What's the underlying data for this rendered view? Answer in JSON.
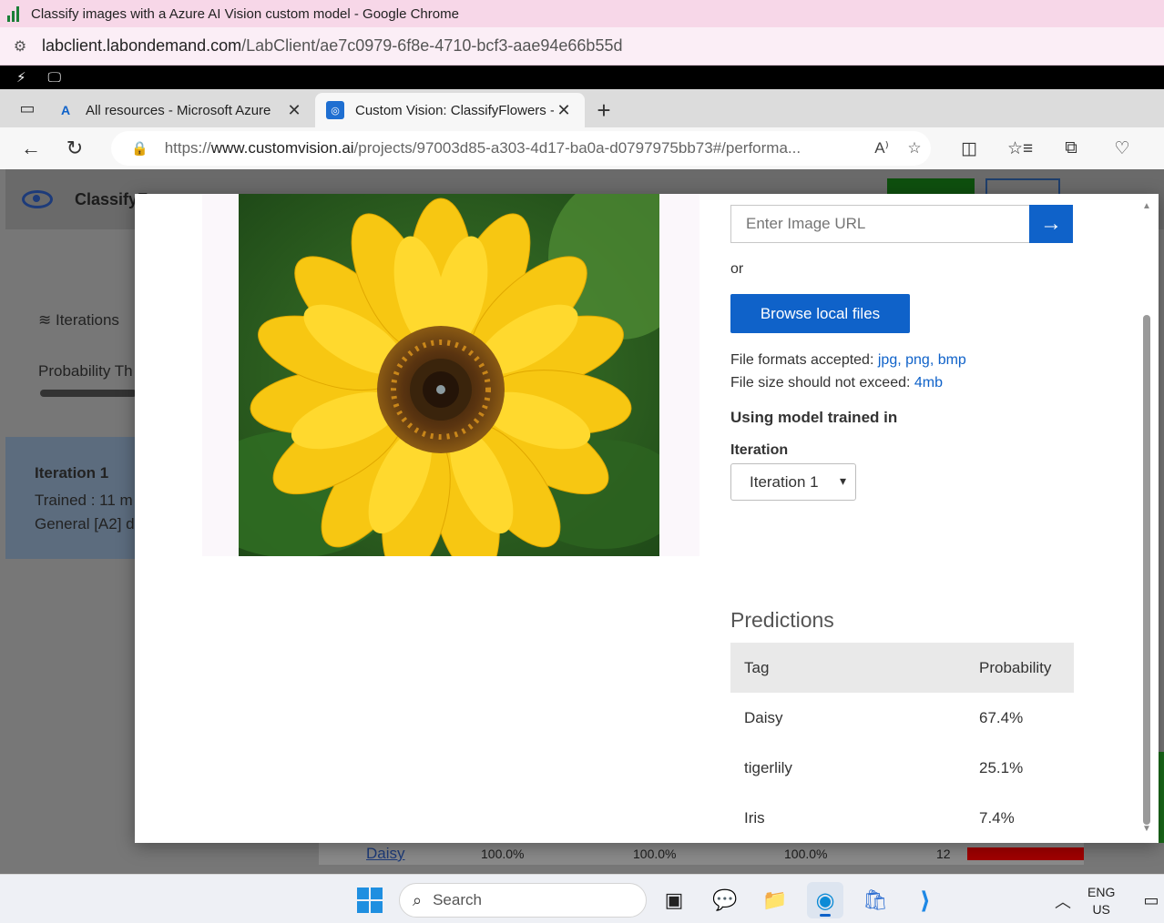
{
  "window": {
    "title": "Classify images with a Azure AI Vision custom model - Google Chrome",
    "url_domain": "labclient.labondemand.com",
    "url_path": "/LabClient/ae7c0979-6f8e-4710-bcf3-aae94e66b55d"
  },
  "tabs": [
    {
      "label": "All resources - Microsoft Azure"
    },
    {
      "label": "Custom Vision: ClassifyFlowers -"
    }
  ],
  "address": {
    "prefix": "https://",
    "domain": "www.customvision.ai",
    "path": "/projects/97003d85-a303-4d17-ba0a-d0797975bb73#/performa..."
  },
  "background": {
    "project_title": "ClassifyF",
    "iterations_label": "Iterations",
    "probability_label": "Probability Th",
    "iteration_card": {
      "title": "Iteration 1",
      "trained": "Trained : 11 m",
      "domain": "General [A2] d"
    },
    "bottom_row": {
      "tag": "Daisy",
      "v1": "100.0%",
      "v2": "100.0%",
      "v3": "100.0%",
      "count": "12"
    }
  },
  "quick_test": {
    "url_placeholder": "Enter Image URL",
    "or_text": "or",
    "browse_label": "Browse local files",
    "formats_label": "File formats accepted:",
    "formats": [
      "jpg",
      "png",
      "bmp"
    ],
    "size_label": "File size should not exceed:",
    "size_value": "4mb",
    "model_title": "Using model trained in",
    "iteration_label": "Iteration",
    "iteration_selected": "Iteration 1"
  },
  "predictions": {
    "title": "Predictions",
    "headers": {
      "tag": "Tag",
      "probability": "Probability"
    },
    "rows": [
      {
        "tag": "Daisy",
        "probability": "67.4%"
      },
      {
        "tag": "tigerlily",
        "probability": "25.1%"
      },
      {
        "tag": "Iris",
        "probability": "7.4%"
      }
    ]
  },
  "taskbar": {
    "search_placeholder": "Search",
    "lang_line1": "ENG",
    "lang_line2": "US"
  }
}
